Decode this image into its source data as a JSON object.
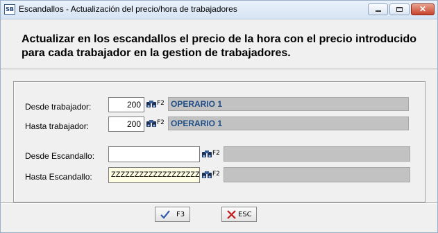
{
  "window": {
    "icon_text": "SB",
    "title": "Escandallos - Actualización del precio/hora de trabajadores",
    "close_glyph": "✕"
  },
  "heading": "Actualizar en los escandallos el precio de la hora con el precio introducido para cada trabajador en la gestion de trabajadores.",
  "fields": {
    "desde_trabajador": {
      "label": "Desde trabajador:",
      "value": "200",
      "lookup_key": "F2",
      "description": "OPERARIO 1"
    },
    "hasta_trabajador": {
      "label": "Hasta trabajador:",
      "value": "200",
      "lookup_key": "F2",
      "description": "OPERARIO 1"
    },
    "desde_escandallo": {
      "label": "Desde Escandallo:",
      "value": "",
      "lookup_key": "F2",
      "description": ""
    },
    "hasta_escandallo": {
      "label": "Hasta Escandallo:",
      "value": "ZZZZZZZZZZZZZZZZZZZ",
      "lookup_key": "F2",
      "description": ""
    }
  },
  "buttons": {
    "accept": {
      "label": "F3",
      "icon": "check-icon"
    },
    "cancel": {
      "label": "ESC",
      "icon": "x-icon"
    }
  }
}
